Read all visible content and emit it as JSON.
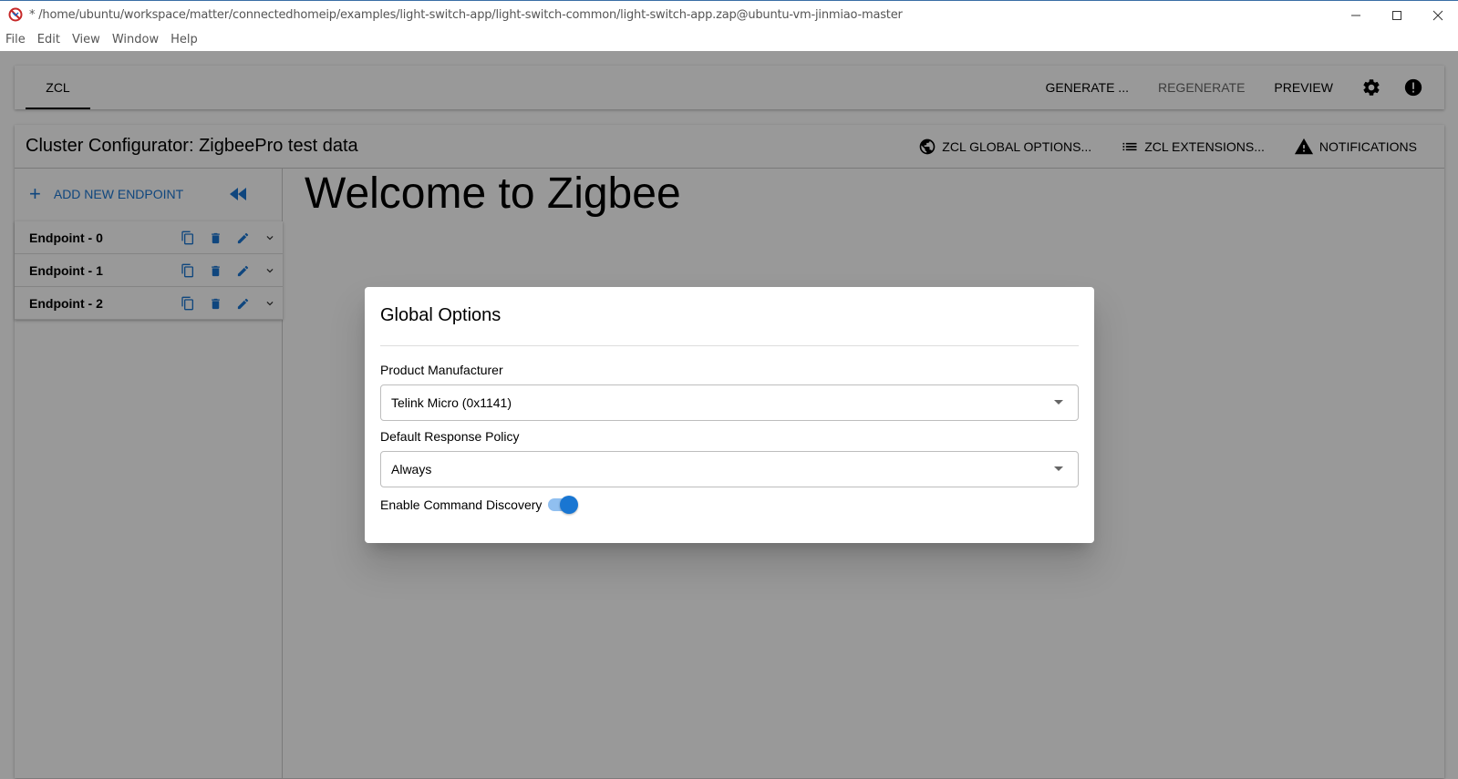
{
  "window": {
    "title": "* /home/ubuntu/workspace/matter/connectedhomeip/examples/light-switch-app/light-switch-common/light-switch-app.zap@ubuntu-vm-jinmiao-master",
    "minimize": "—",
    "maximize": "☐",
    "close": "✕"
  },
  "menu": {
    "items": [
      "File",
      "Edit",
      "View",
      "Window",
      "Help"
    ]
  },
  "toolbar": {
    "tab": "ZCL",
    "generate": "GENERATE ...",
    "regenerate": "REGENERATE",
    "preview": "PREVIEW"
  },
  "header": {
    "title": "Cluster Configurator: ZigbeePro test data",
    "global_options": "ZCL GLOBAL OPTIONS...",
    "extensions": "ZCL EXTENSIONS...",
    "notifications": "NOTIFICATIONS"
  },
  "sidebar": {
    "add_endpoint": "ADD NEW ENDPOINT",
    "endpoints": [
      "Endpoint - 0",
      "Endpoint - 1",
      "Endpoint - 2"
    ]
  },
  "main": {
    "welcome": "Welcome to Zigbee"
  },
  "dialog": {
    "title": "Global Options",
    "manufacturer_label": "Product Manufacturer",
    "manufacturer_value": "Telink Micro (0x1141)",
    "policy_label": "Default Response Policy",
    "policy_value": "Always",
    "discovery_label": "Enable Command Discovery",
    "discovery_enabled": true
  },
  "colors": {
    "accent": "#1976d2",
    "overlay": "rgba(0,0,0,0.4)"
  }
}
